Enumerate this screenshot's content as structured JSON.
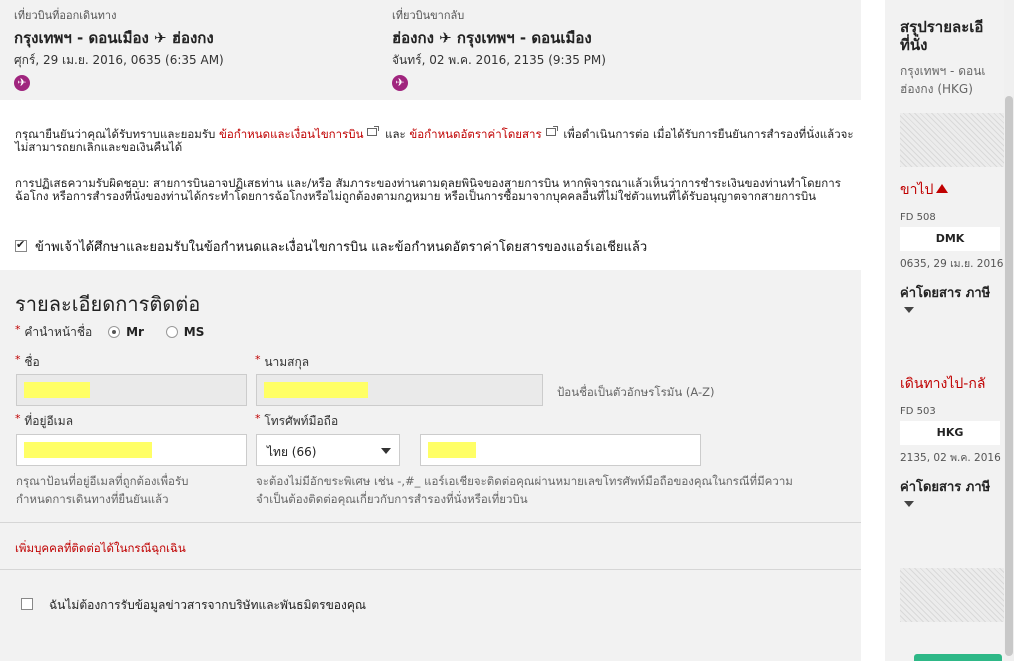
{
  "outbound": {
    "label": "เที่ยวบินที่ออกเดินทาง",
    "route": "กรุงเทพฯ - ดอนเมือง ✈ ฮ่องกง",
    "datetime": "ศุกร์, 29 เม.ย. 2016, 0635 (6:35 AM)"
  },
  "return": {
    "label": "เที่ยวบินขากลับ",
    "route": "ฮ่องกง ✈ กรุงเทพฯ - ดอนเมือง",
    "datetime": "จันทร์, 02 พ.ค. 2016, 2135 (9:35 PM)"
  },
  "terms": {
    "prefix": "กรุณายืนยันว่าคุณได้รับทราบและยอมรับ",
    "link1": "ข้อกำหนดและเงื่อนไขการบิน",
    "and": "และ",
    "link2": "ข้อกำหนดอัตราค่าโดยสาร",
    "suffix": "เพื่อดำเนินการต่อ เมื่อได้รับการยืนยันการสำรองที่นั่งแล้วจะไม่สามารถยกเลิกและขอเงินคืนได้",
    "disclaimer": "การปฏิเสธความรับผิดชอบ: สายการบินอาจปฏิเสธท่าน และ/หรือ สัมภาระของท่านตามดุลยพินิจของสายการบิน หากพิจารณาแล้วเห็นว่าการชำระเงินของท่านทำโดยการฉ้อโกง หรือการสำรองที่นั่งของท่านได้กระทำโดยการฉ้อโกงหรือไม่ถูกต้องตามกฎหมาย หรือเป็นการซื้อมาจากบุคคลอื่นที่ไม่ใช่ตัวแทนที่ได้รับอนุญาตจากสายการบิน",
    "accept_label": "ข้าพเจ้าได้ศึกษาและยอมรับในข้อกำหนดและเงื่อนไขการบิน และข้อกำหนดอัตราค่าโดยสารของแอร์เอเชียแล้ว",
    "accept_checked": true
  },
  "contact": {
    "heading": "รายละเอียดการติดต่อ",
    "title_label": "คำนำหน้าชื่อ",
    "title_options": [
      "Mr",
      "MS"
    ],
    "title_selected": "Mr",
    "first_name_label": "ชื่อ",
    "last_name_label": "นามสกุล",
    "name_hint": "ป้อนชื่อเป็นตัวอักษรโรมัน (A-Z)",
    "email_label": "ที่อยู่อีเมล",
    "phone_label": "โทรศัพท์มือถือ",
    "country_code": "ไทย (66)",
    "email_hint_1": "กรุณาป้อนที่อยู่อีเมลที่ถูกต้องเพื่อรับ",
    "email_hint_2": "กำหนดการเดินทางที่ยืนยันแล้ว",
    "phone_hint_1": "จะต้องไม่มีอักขระพิเศษ เช่น -,#_ แอร์เอเชียจะติดต่อคุณผ่านหมายเลขโทรศัพท์มือถือของคุณในกรณีที่มีความ",
    "phone_hint_2": "จำเป็นต้องติดต่อคุณเกี่ยวกับการสำรองที่นั่งหรือเที่ยวบิน",
    "emergency_link": "เพิ่มบุคคลที่ติดต่อได้ในกรณีฉุกเฉิน",
    "optout_label": "ฉันไม่ต้องการรับข้อมูลข่าวสารจากบริษัทและพันธมิตรของคุณ",
    "optout_checked": false
  },
  "summary": {
    "heading_1": "สรุปรายละเอี",
    "heading_2": "ที่นั่ง",
    "route_1": "กรุงเทพฯ - ดอนเ",
    "route_2": "ฮ่องกง (HKG)",
    "depart_title": "ขาไป",
    "depart_flight": "FD 508",
    "depart_code": "DMK",
    "depart_date": "0635, 29 เม.ย. 2016",
    "depart_fare": "ค่าโดยสาร ภาษี",
    "return_title": "เดินทางไป-กลั",
    "return_flight": "FD 503",
    "return_code": "HKG",
    "return_date": "2135, 02 พ.ค. 2016",
    "return_fare": "ค่าโดยสาร ภาษี"
  },
  "colors": {
    "accent_red": "#c00000",
    "plane_badge": "#a0257e",
    "panel_grey": "#f2f2f2",
    "highlight": "#ffff66",
    "cta_green": "#2eb887"
  }
}
